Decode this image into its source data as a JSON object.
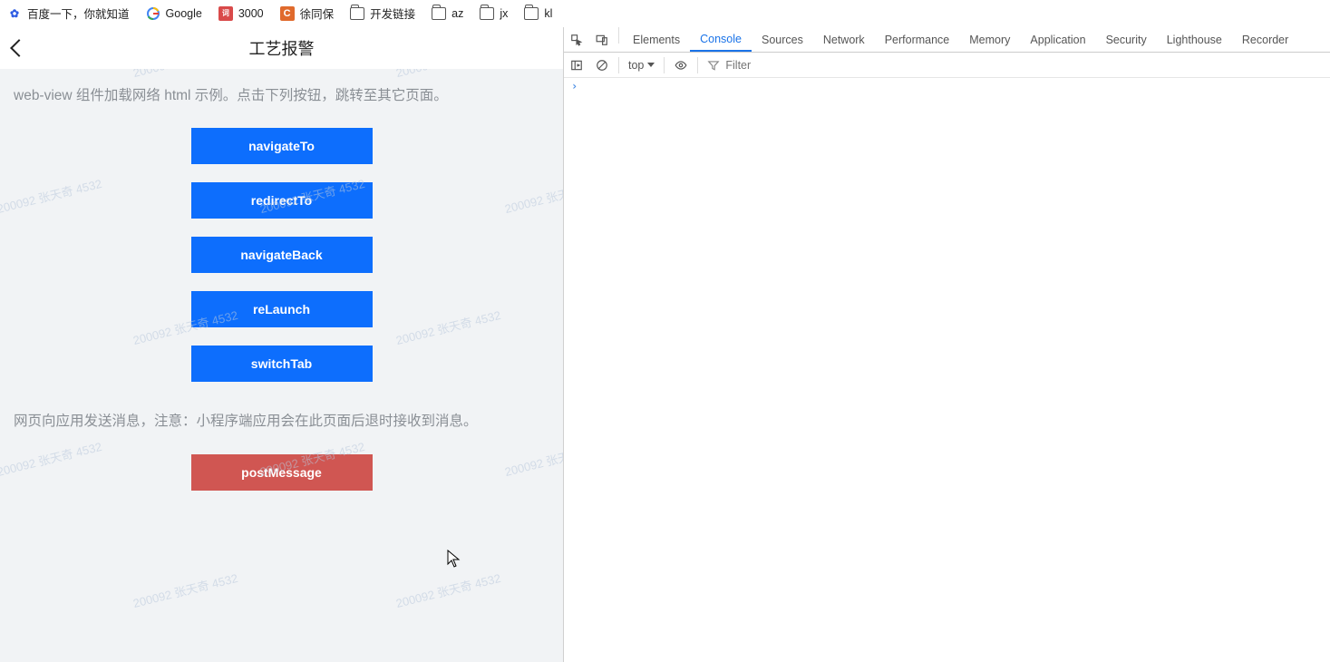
{
  "bookmarks": [
    {
      "icon": "baidu",
      "label": "百度一下，你就知道"
    },
    {
      "icon": "google",
      "label": "Google"
    },
    {
      "icon": "red-sq",
      "glyph": "词",
      "label": "3000"
    },
    {
      "icon": "orange-sq",
      "glyph": "C",
      "label": "徐同保"
    },
    {
      "icon": "folder",
      "label": "开发链接"
    },
    {
      "icon": "folder",
      "label": "az"
    },
    {
      "icon": "folder",
      "label": "jx"
    },
    {
      "icon": "folder",
      "label": "kl"
    }
  ],
  "mobile": {
    "title": "工艺报警",
    "desc1": "web-view 组件加载网络 html 示例。点击下列按钮，跳转至其它页面。",
    "buttons": {
      "navigateTo": "navigateTo",
      "redirectTo": "redirectTo",
      "navigateBack": "navigateBack",
      "reLaunch": "reLaunch",
      "switchTab": "switchTab"
    },
    "desc2": "网页向应用发送消息，注意：小程序端应用会在此页面后退时接收到消息。",
    "postMessage": "postMessage",
    "watermark_text": "200092 张天奇 4532"
  },
  "devtools": {
    "tabs": {
      "elements": "Elements",
      "console": "Console",
      "sources": "Sources",
      "network": "Network",
      "performance": "Performance",
      "memory": "Memory",
      "application": "Application",
      "security": "Security",
      "lighthouse": "Lighthouse",
      "recorder": "Recorder"
    },
    "active_tab": "console",
    "context": "top",
    "filter_placeholder": "Filter"
  }
}
